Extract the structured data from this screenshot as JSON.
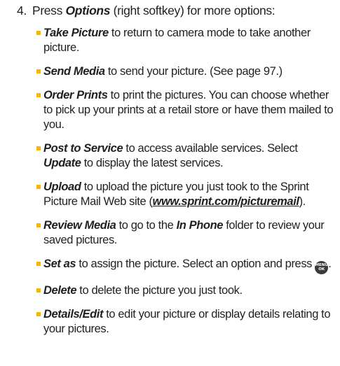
{
  "step": {
    "number": "4.",
    "pre": "Press ",
    "term": "Options",
    "post": " (right softkey) for more options:"
  },
  "options": [
    {
      "term": "Take Picture",
      "text": " to return to camera mode to take another picture."
    },
    {
      "term": "Send Media",
      "text": " to send your picture. (See page 97.)"
    },
    {
      "term": "Order Prints",
      "text": " to print the pictures. You can choose whether to pick up your prints at a retail store or have them mailed to you."
    },
    {
      "term": "Post to Service",
      "text": " to access available services. Select ",
      "term2": "Update",
      "text2": " to display the latest services."
    },
    {
      "term": "Upload",
      "text": " to upload the picture you just took to the Sprint Picture Mail Web site (",
      "link": "www.sprint.com/picturemail",
      "text2": ")."
    },
    {
      "term": "Review Media",
      "text": " to go to the ",
      "term2": "In Phone",
      "text2": " folder to review your saved pictures."
    },
    {
      "term": "Set as",
      "text": " to assign the picture. Select an option and press ",
      "key_top": "MENU",
      "key_bottom": "OK",
      "text2": "."
    },
    {
      "term": "Delete",
      "text": " to delete the picture you just took."
    },
    {
      "term": "Details/Edit",
      "text": " to edit your picture or display details relating to your pictures."
    }
  ],
  "colors": {
    "bullet": "#f5b800",
    "text": "#231f20",
    "menu_key": "#3a3a3a"
  }
}
